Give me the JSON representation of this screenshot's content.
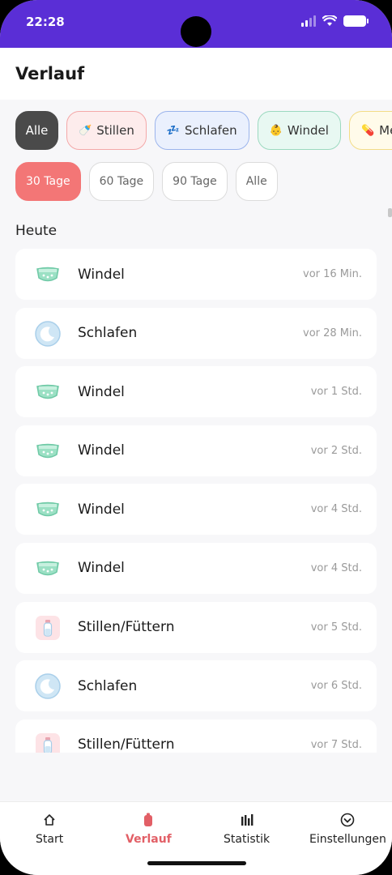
{
  "status_bar": {
    "time": "22:28"
  },
  "header": {
    "title": "Verlauf"
  },
  "filters": {
    "categories": [
      {
        "label": "Alle",
        "icon": ""
      },
      {
        "label": "Stillen",
        "icon": "🍼"
      },
      {
        "label": "Schlafen",
        "icon": "💤"
      },
      {
        "label": "Windel",
        "icon": "👶"
      },
      {
        "label": "Medi",
        "icon": "💊"
      }
    ],
    "ranges": [
      "30 Tage",
      "60 Tage",
      "90 Tage",
      "Alle"
    ]
  },
  "section": {
    "title": "Heute"
  },
  "entries": [
    {
      "label": "Windel",
      "time": "vor 16 Min.",
      "icon": "diaper-icon"
    },
    {
      "label": "Schlafen",
      "time": "vor 28 Min.",
      "icon": "moon-icon"
    },
    {
      "label": "Windel",
      "time": "vor 1 Std.",
      "icon": "diaper-icon"
    },
    {
      "label": "Windel",
      "time": "vor 2 Std.",
      "icon": "diaper-icon"
    },
    {
      "label": "Windel",
      "time": "vor 4 Std.",
      "icon": "diaper-icon"
    },
    {
      "label": "Windel",
      "time": "vor 4 Std.",
      "icon": "diaper-icon"
    },
    {
      "label": "Stillen/Füttern",
      "time": "vor 5 Std.",
      "icon": "bottle-icon"
    },
    {
      "label": "Schlafen",
      "time": "vor 6 Std.",
      "icon": "moon-icon"
    },
    {
      "label": "Stillen/Füttern",
      "time": "vor 7 Std.",
      "icon": "bottle-icon"
    }
  ],
  "nav": {
    "items": [
      {
        "label": "Start",
        "icon": "home-icon"
      },
      {
        "label": "Verlauf",
        "icon": "history-icon"
      },
      {
        "label": "Statistik",
        "icon": "chart-icon"
      },
      {
        "label": "Einstellungen",
        "icon": "settings-icon"
      }
    ]
  },
  "colors": {
    "status_bar": "#5a2ed6",
    "accent": "#f37676",
    "nav_active": "#e25f66"
  }
}
